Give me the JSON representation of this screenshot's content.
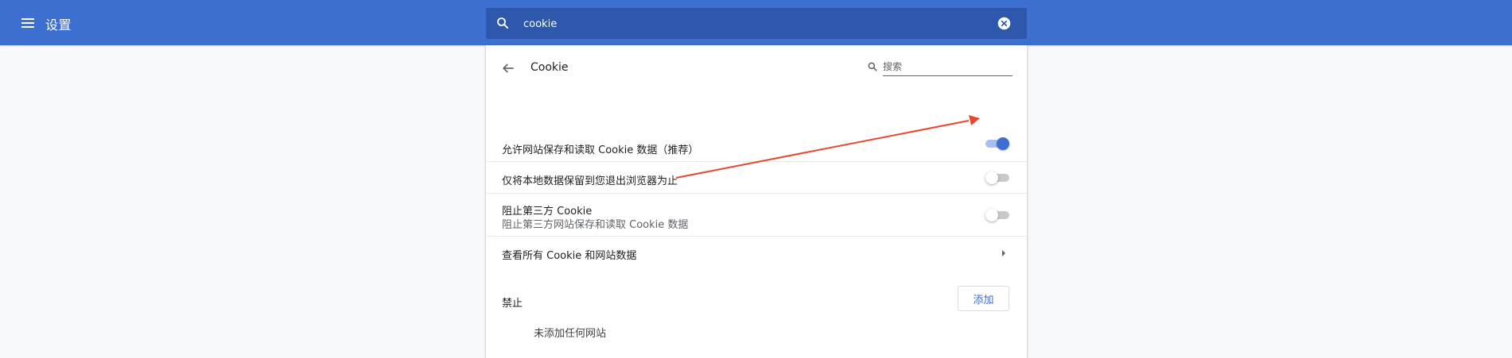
{
  "header": {
    "title": "设置",
    "menu_icon": "hamburger-menu-icon",
    "search": {
      "value": "cookie",
      "search_icon": "search-icon",
      "clear_icon": "clear-circle-icon"
    }
  },
  "page": {
    "title": "Cookie",
    "back_icon": "arrow-back-icon",
    "search_placeholder": "搜索"
  },
  "settings": [
    {
      "label": "允许网站保存和读取 Cookie 数据（推荐）",
      "toggle": true
    },
    {
      "label": "仅将本地数据保留到您退出浏览器为止",
      "toggle": false
    },
    {
      "label": "阻止第三方 Cookie",
      "sublabel": "阻止第三方网站保存和读取 Cookie 数据",
      "toggle": false
    },
    {
      "label": "查看所有 Cookie 和网站数据",
      "icon": "chevron-right-icon"
    }
  ],
  "block_section": {
    "label": "禁止",
    "add_button": "添加",
    "empty_text": "未添加任何网站"
  },
  "colors": {
    "header_bg": "#3d6fd0",
    "search_bg": "#2e58ab",
    "accent": "#3d6fd0",
    "annotation_arrow": "#e8472f"
  }
}
